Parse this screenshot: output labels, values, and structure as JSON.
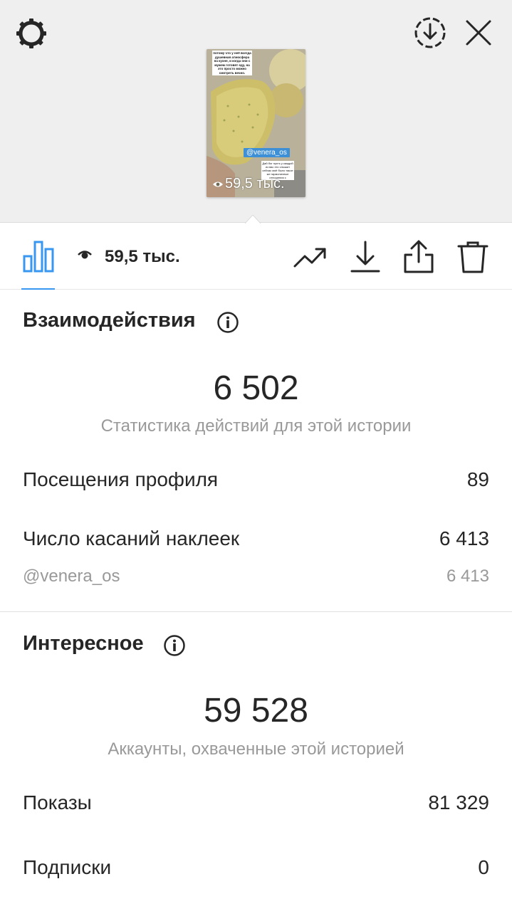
{
  "story_preview": {
    "caption_text": "потому что у неё всегда душевная атмосфера на кухне, и когда они с мужем готовят еду, на это просто можно смотреть вечно.",
    "sticker_mention": "@venera_os",
    "note_text": "Дай бог пусть у каждой из вас это слышит сейчас моё было такое же гармоничные отношения с",
    "views_overlay": "59,5 тыс."
  },
  "toolbar": {
    "views_count": "59,5 тыс."
  },
  "interactions": {
    "title": "Взаимодействия",
    "total": "6 502",
    "subtitle": "Статистика действий для этой истории",
    "rows": [
      {
        "label": "Посещения профиля",
        "value": "89"
      },
      {
        "label": "Число касаний наклеек",
        "value": "6 413"
      }
    ],
    "sub_row": {
      "label": "@venera_os",
      "value": "6 413"
    }
  },
  "discovery": {
    "title": "Интересное",
    "total": "59 528",
    "subtitle": "Аккаунты, охваченные этой историей",
    "rows": [
      {
        "label": "Показы",
        "value": "81 329"
      },
      {
        "label": "Подписки",
        "value": "0"
      }
    ]
  },
  "colors": {
    "accent": "#3897f0",
    "muted_text": "#999999",
    "header_bg": "#efefef"
  },
  "icons": [
    "gear-icon",
    "download-circle-icon",
    "close-icon",
    "bar-chart-icon",
    "eye-icon",
    "trending-up-icon",
    "download-icon",
    "share-icon",
    "trash-icon",
    "info-icon"
  ]
}
